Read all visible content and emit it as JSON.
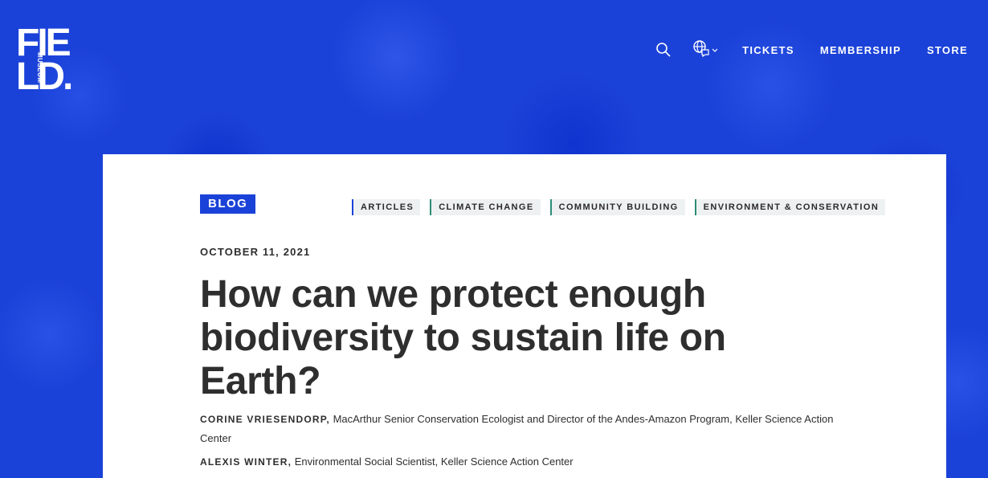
{
  "brand": {
    "logo_line1": "FIE",
    "logo_line2": "LD.",
    "logo_sub": "MUSEUM"
  },
  "nav": {
    "links": [
      "TICKETS",
      "MEMBERSHIP",
      "STORE"
    ],
    "icons": [
      "search-icon",
      "globe-language-icon",
      "chevron-down-icon"
    ]
  },
  "article": {
    "section": "BLOG",
    "tags": [
      "ARTICLES",
      "CLIMATE CHANGE",
      "COMMUNITY BUILDING",
      "ENVIRONMENT & CONSERVATION"
    ],
    "date": "OCTOBER 11, 2021",
    "title": "How can we protect enough biodiversity to sustain life on Earth?",
    "authors": [
      {
        "name": "CORINE VRIESENDORP,",
        "role": "MacArthur Senior Conservation Ecologist and Director of the Andes-Amazon Program, Keller Science Action Center"
      },
      {
        "name": "ALEXIS WINTER,",
        "role": "Environmental Social Scientist, Keller Science Action Center"
      }
    ]
  },
  "colors": {
    "brand_blue": "#1b42d8",
    "tag_accent": "#2c8c77",
    "text": "#2e2e2e"
  }
}
